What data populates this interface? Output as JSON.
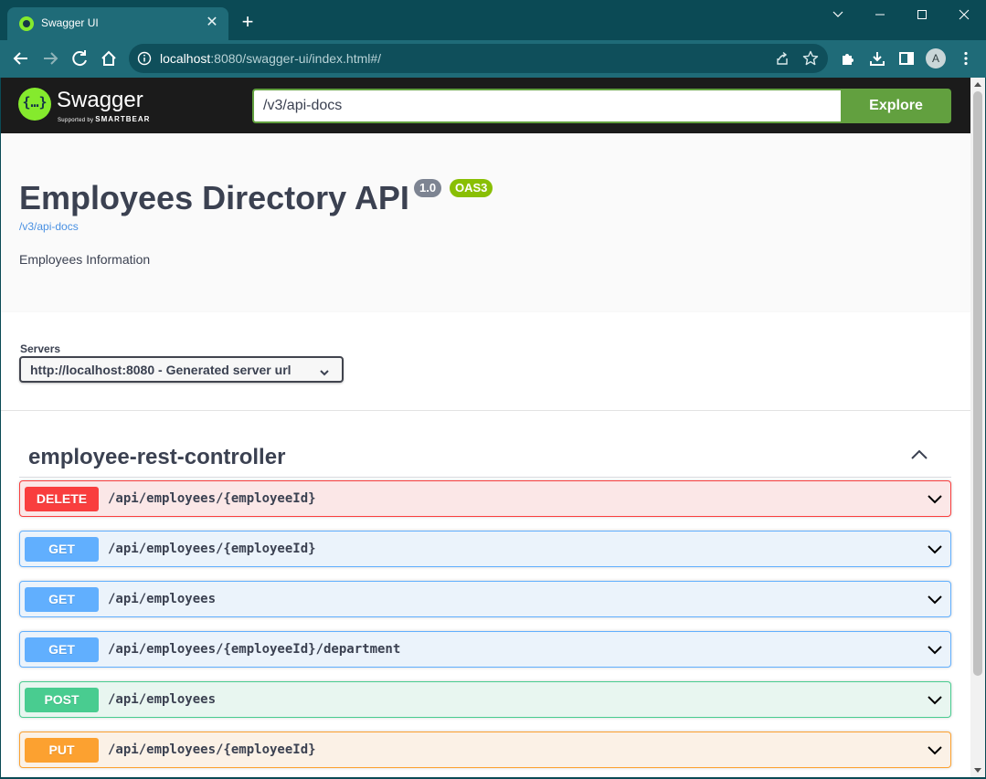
{
  "browser": {
    "tab_title": "Swagger UI",
    "url_host": "localhost",
    "url_rest": ":8080/swagger-ui/index.html#/",
    "profile_initial": "A"
  },
  "swagger_topbar": {
    "logo_text": "Swagger",
    "logo_supported_by": "Supported by",
    "logo_smartbear": "SMARTBEAR",
    "url_value": "/v3/api-docs",
    "explore_label": "Explore"
  },
  "info": {
    "title": "Employees Directory API",
    "version": "1.0",
    "oas": "OAS3",
    "docs_link": "/v3/api-docs",
    "description": "Employees Information"
  },
  "servers": {
    "label": "Servers",
    "selected": "http://localhost:8080 - Generated server url"
  },
  "tag": {
    "name": "employee-rest-controller"
  },
  "operations": [
    {
      "method": "DELETE",
      "path": "/api/employees/{employeeId}"
    },
    {
      "method": "GET",
      "path": "/api/employees/{employeeId}"
    },
    {
      "method": "GET",
      "path": "/api/employees"
    },
    {
      "method": "GET",
      "path": "/api/employees/{employeeId}/department"
    },
    {
      "method": "POST",
      "path": "/api/employees"
    },
    {
      "method": "PUT",
      "path": "/api/employees/{employeeId}"
    }
  ],
  "colors": {
    "DELETE": {
      "badge": "#f93e3e",
      "bg": "#fbe7e7",
      "border": "#f93e3e"
    },
    "GET": {
      "badge": "#61affe",
      "bg": "#ebf3fb",
      "border": "#61affe"
    },
    "POST": {
      "badge": "#49cc90",
      "bg": "#e8f6f0",
      "border": "#49cc90"
    },
    "PUT": {
      "badge": "#fca130",
      "bg": "#fbf1e6",
      "border": "#fca130"
    },
    "swagger_green": "#85ea2d",
    "explore_green": "#62a03f"
  }
}
